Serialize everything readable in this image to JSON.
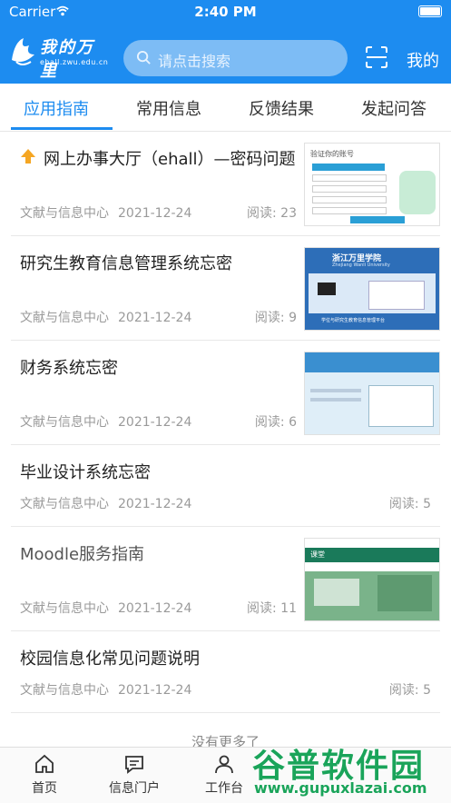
{
  "status_bar": {
    "carrier": "Carrier",
    "time": "2:40 PM"
  },
  "header": {
    "logo_text": "我的万里",
    "logo_url": "ehall.zwu.edu.cn",
    "search_placeholder": "请点击搜索",
    "mine_label": "我的",
    "brand_color": "#1d8cf0"
  },
  "tabs": [
    "应用指南",
    "常用信息",
    "反馈结果",
    "发起问答"
  ],
  "active_tab": "应用指南",
  "articles": [
    {
      "title": "网上办事大厅（ehall）—密码问题",
      "source": "文献与信息中心",
      "date": "2021-12-24",
      "reads": "阅读: 23",
      "pinned": true,
      "has_thumb": true,
      "thumb_texts": [
        "验证你的账号"
      ]
    },
    {
      "title": "研究生教育信息管理系统忘密",
      "source": "文献与信息中心",
      "date": "2021-12-24",
      "reads": "阅读: 9",
      "pinned": false,
      "has_thumb": true,
      "thumb_texts": [
        "浙江万里学院",
        "Zhejiang Wanli University",
        "学位与研究生教育信息管理平台"
      ]
    },
    {
      "title": "财务系统忘密",
      "source": "文献与信息中心",
      "date": "2021-12-24",
      "reads": "阅读: 6",
      "pinned": false,
      "has_thumb": true,
      "thumb_texts": []
    },
    {
      "title": "毕业设计系统忘密",
      "source": "文献与信息中心",
      "date": "2021-12-24",
      "reads": "阅读: 5",
      "pinned": false,
      "has_thumb": false,
      "thumb_texts": []
    },
    {
      "title": "Moodle服务指南",
      "source": "文献与信息中心",
      "date": "2021-12-24",
      "reads": "阅读: 11",
      "pinned": false,
      "has_thumb": true,
      "thumb_texts": [
        "课堂"
      ]
    },
    {
      "title": "校园信息化常见问题说明",
      "source": "文献与信息中心",
      "date": "2021-12-24",
      "reads": "阅读: 5",
      "pinned": false,
      "has_thumb": false,
      "thumb_texts": []
    }
  ],
  "no_more_text": "没有更多了",
  "tabbar": [
    {
      "label": "首页",
      "icon": "home-icon"
    },
    {
      "label": "信息门户",
      "icon": "message-icon"
    },
    {
      "label": "工作台",
      "icon": "person-icon"
    }
  ],
  "watermark": {
    "main": "谷普软件园",
    "url": "www.gupuxlazai.com"
  }
}
